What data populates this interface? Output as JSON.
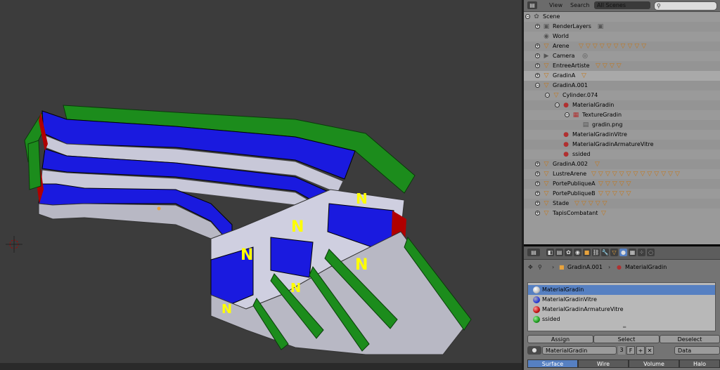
{
  "viewport": {
    "face_label": "N"
  },
  "outliner": {
    "menu": {
      "view": "View",
      "search": "Search",
      "scenes": "All Scenes"
    },
    "rows": [
      {
        "label": "Scene",
        "icon": "scene-icon"
      },
      {
        "label": "RenderLayers",
        "icon": "renderlayers-icon"
      },
      {
        "label": "World",
        "icon": "world-icon"
      },
      {
        "label": "Arene",
        "icon": "mesh-icon"
      },
      {
        "label": "Camera",
        "icon": "camera-icon"
      },
      {
        "label": "EntreeArtiste",
        "icon": "mesh-icon"
      },
      {
        "label": "GradinA",
        "icon": "mesh-icon"
      },
      {
        "label": "GradinA.001",
        "icon": "mesh-icon"
      },
      {
        "label": "Cylinder.074",
        "icon": "mesh-data-icon"
      },
      {
        "label": "MaterialGradin",
        "icon": "material-icon"
      },
      {
        "label": "TextureGradin",
        "icon": "texture-icon"
      },
      {
        "label": "gradin.png",
        "icon": "image-icon"
      },
      {
        "label": "MaterialGradinVitre",
        "icon": "material-icon"
      },
      {
        "label": "MaterialGradinArmatureVitre",
        "icon": "material-icon"
      },
      {
        "label": "ssided",
        "icon": "material-icon"
      },
      {
        "label": "GradinA.002",
        "icon": "mesh-icon"
      },
      {
        "label": "LustreArene",
        "icon": "mesh-icon"
      },
      {
        "label": "PortePubliqueA",
        "icon": "mesh-icon"
      },
      {
        "label": "PortePubliqueB",
        "icon": "mesh-icon"
      },
      {
        "label": "Stade",
        "icon": "mesh-icon"
      },
      {
        "label": "TapisCombatant",
        "icon": "mesh-icon"
      }
    ]
  },
  "properties": {
    "breadcrumb": {
      "object": "GradinA.001",
      "material": "MaterialGradin"
    },
    "materials": [
      {
        "name": "MaterialGradin",
        "color": "#c0c0c0"
      },
      {
        "name": "MaterialGradinVitre",
        "color": "#2a3bd6"
      },
      {
        "name": "MaterialGradinArmatureVitre",
        "color": "#c21010"
      },
      {
        "name": "ssided",
        "color": "#1c9a1c"
      }
    ],
    "actions": {
      "assign": "Assign",
      "select": "Select",
      "deselect": "Deselect"
    },
    "material_field": {
      "name": "MaterialGradin",
      "users": "3",
      "fake_user": "F",
      "link": "Data"
    },
    "tabs": {
      "surface": "Surface",
      "wire": "Wire",
      "volume": "Volume",
      "halo": "Halo"
    }
  }
}
